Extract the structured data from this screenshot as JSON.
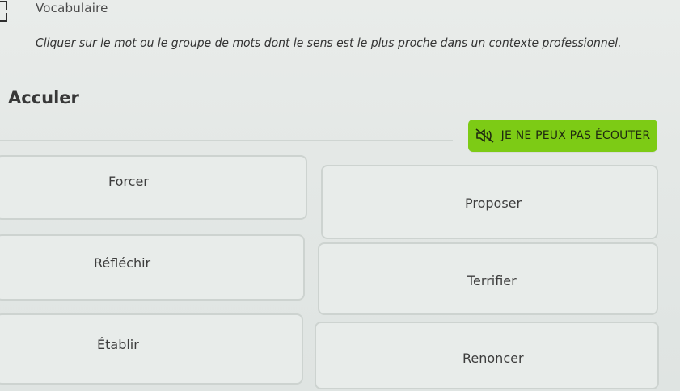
{
  "header": {
    "section_label": "Vocabulaire",
    "instruction": "Cliquer sur le mot ou le groupe de mots dont le sens est le plus proche dans un contexte professionnel."
  },
  "question": {
    "word": "Acculer"
  },
  "listen_button": {
    "label": "JE NE PEUX PAS ÉCOUTER",
    "icon": "speaker-muted-icon"
  },
  "options": [
    {
      "label": "Forcer"
    },
    {
      "label": "Proposer"
    },
    {
      "label": "Réfléchir"
    },
    {
      "label": "Terrifier"
    },
    {
      "label": "Établir"
    },
    {
      "label": "Renoncer"
    }
  ],
  "colors": {
    "accent": "#7dcb15",
    "background": "#e6eae8",
    "option_border": "#cdd3d0"
  }
}
